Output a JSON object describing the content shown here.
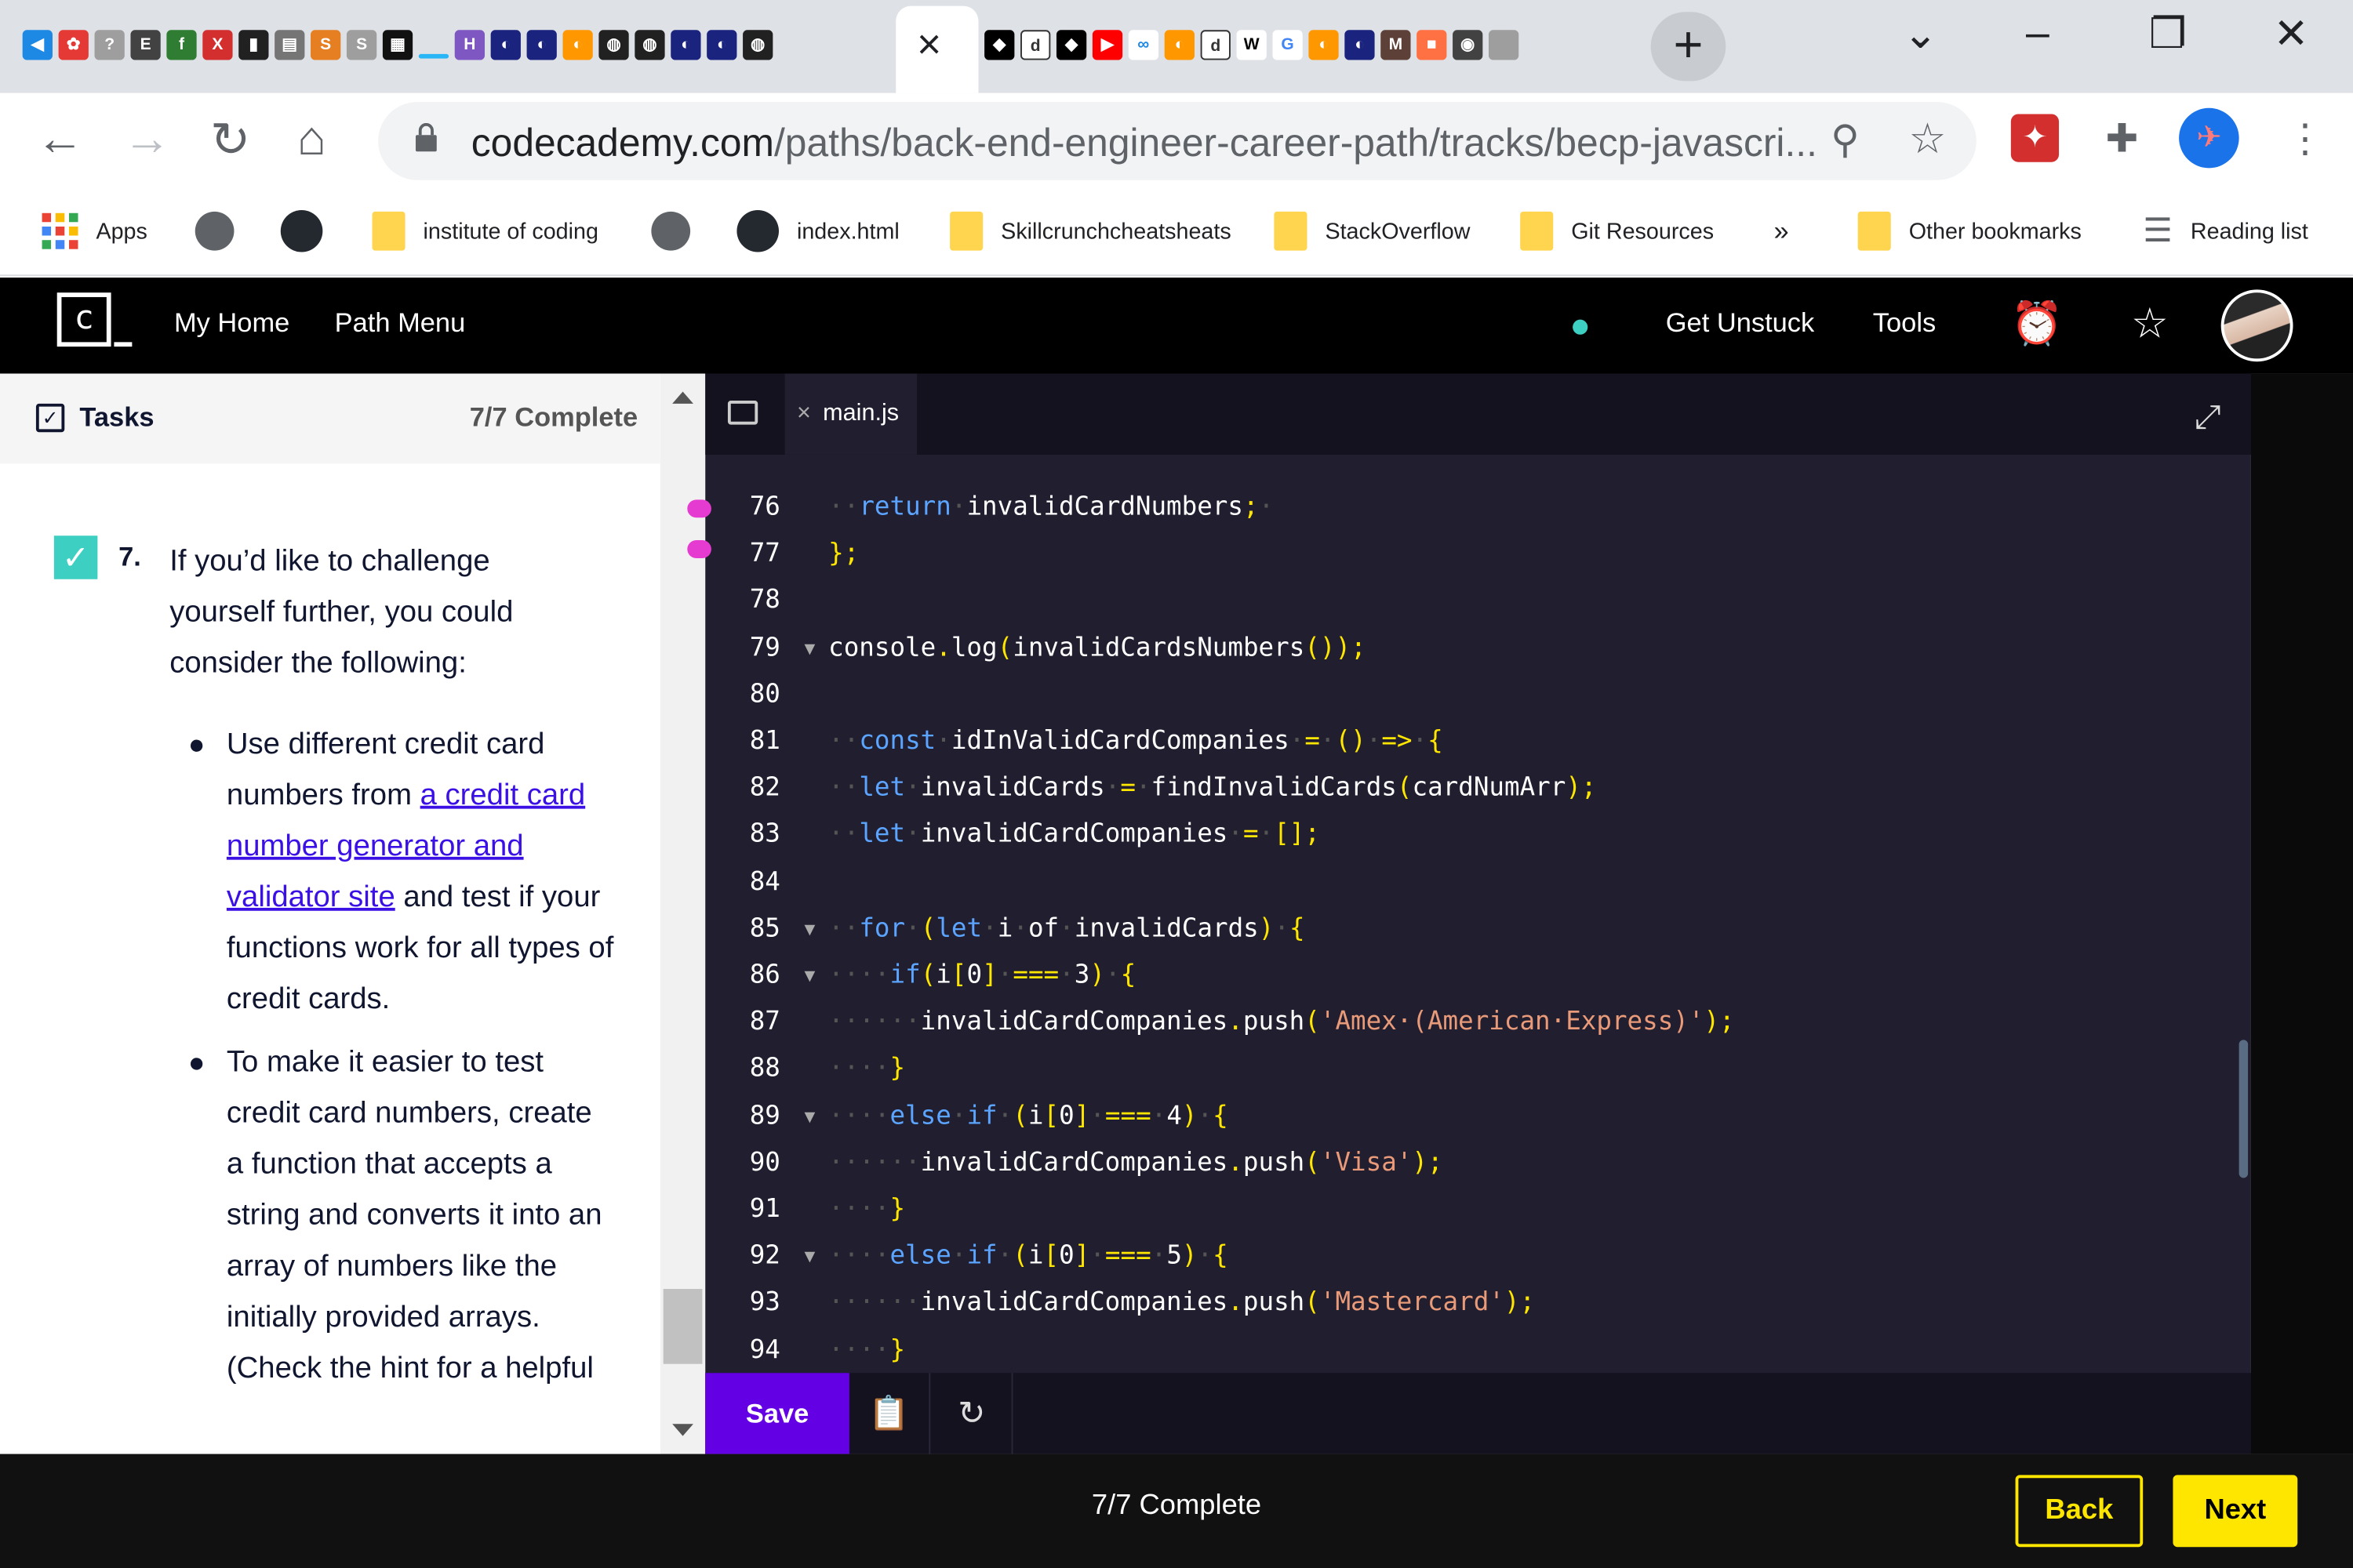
{
  "browser": {
    "active_tab_close": "×",
    "new_tab": "+",
    "url_host": "codecademy.com",
    "url_path": "/paths/back-end-engineer-career-path/tracks/becp-javascri...",
    "bookmarks": [
      "Apps",
      "institute of coding",
      "index.html",
      "Skillcrunchcheatsheats",
      "StackOverflow",
      "Git Resources",
      "»",
      "Other bookmarks",
      "Reading list"
    ]
  },
  "header": {
    "my_home": "My Home",
    "path_menu": "Path Menu",
    "get_unstuck": "Get Unstuck",
    "tools": "Tools"
  },
  "tasks": {
    "title": "Tasks",
    "progress": "7/7 Complete",
    "task_number": "7.",
    "intro": "If you’d like to challenge yourself further, you could consider the following:",
    "bullet1_before": "Use different credit card numbers from ",
    "bullet1_link": "a credit card number generator and validator site",
    "bullet1_after": " and test if your functions work for all types of credit cards.",
    "bullet2": "To make it easier to test credit card numbers, create a function that accepts a string and converts it into an array of numbers like the initially provided arrays. (Check the hint for a helpful"
  },
  "editor": {
    "file_name": "main.js",
    "save_label": "Save",
    "lines": [
      {
        "n": "76",
        "fold": "",
        "ind": "··",
        "tokens": [
          [
            "kw",
            "return"
          ],
          [
            "ws",
            "·"
          ],
          [
            "",
            "invalidCardNumbers"
          ],
          [
            "pun",
            ";"
          ],
          [
            "ws",
            "·"
          ]
        ]
      },
      {
        "n": "77",
        "fold": "",
        "ind": "",
        "tokens": [
          [
            "pun",
            "};"
          ]
        ]
      },
      {
        "n": "78",
        "fold": "",
        "ind": "",
        "tokens": []
      },
      {
        "n": "79",
        "fold": "▼",
        "ind": "",
        "tokens": [
          [
            "",
            "console"
          ],
          [
            "pun",
            "."
          ],
          [
            "",
            "log"
          ],
          [
            "pun",
            "("
          ],
          [
            "",
            "invalidCardsNumbers"
          ],
          [
            "pun",
            "());"
          ]
        ]
      },
      {
        "n": "80",
        "fold": "",
        "ind": "",
        "tokens": []
      },
      {
        "n": "81",
        "fold": "",
        "ind": "··",
        "tokens": [
          [
            "kw",
            "const"
          ],
          [
            "ws",
            "·"
          ],
          [
            "",
            "idInValidCardCompanies"
          ],
          [
            "ws",
            "·"
          ],
          [
            "pun",
            "="
          ],
          [
            "ws",
            "·"
          ],
          [
            "pun",
            "()"
          ],
          [
            "ws",
            "·"
          ],
          [
            "pun",
            "=>"
          ],
          [
            "ws",
            "·"
          ],
          [
            "pun",
            "{"
          ]
        ]
      },
      {
        "n": "82",
        "fold": "",
        "ind": "··",
        "tokens": [
          [
            "kw",
            "let"
          ],
          [
            "ws",
            "·"
          ],
          [
            "",
            "invalidCards"
          ],
          [
            "ws",
            "·"
          ],
          [
            "pun",
            "="
          ],
          [
            "ws",
            "·"
          ],
          [
            "",
            "findInvalidCards"
          ],
          [
            "pun",
            "("
          ],
          [
            "",
            "cardNumArr"
          ],
          [
            "pun",
            ");"
          ]
        ]
      },
      {
        "n": "83",
        "fold": "",
        "ind": "··",
        "tokens": [
          [
            "kw",
            "let"
          ],
          [
            "ws",
            "·"
          ],
          [
            "",
            "invalidCardCompanies"
          ],
          [
            "ws",
            "·"
          ],
          [
            "pun",
            "="
          ],
          [
            "ws",
            "·"
          ],
          [
            "pun",
            "[];"
          ]
        ]
      },
      {
        "n": "84",
        "fold": "",
        "ind": "",
        "tokens": []
      },
      {
        "n": "85",
        "fold": "▼",
        "ind": "··",
        "tokens": [
          [
            "kw",
            "for"
          ],
          [
            "ws",
            "·"
          ],
          [
            "pun",
            "("
          ],
          [
            "kw",
            "let"
          ],
          [
            "ws",
            "·"
          ],
          [
            "",
            "i"
          ],
          [
            "ws",
            "·"
          ],
          [
            "",
            "of"
          ],
          [
            "ws",
            "·"
          ],
          [
            "",
            "invalidCards"
          ],
          [
            "pun",
            ")"
          ],
          [
            "ws",
            "·"
          ],
          [
            "pun",
            "{"
          ]
        ]
      },
      {
        "n": "86",
        "fold": "▼",
        "ind": "····",
        "tokens": [
          [
            "kw",
            "if"
          ],
          [
            "pun",
            "("
          ],
          [
            "",
            "i"
          ],
          [
            "pun",
            "["
          ],
          [
            "",
            "0"
          ],
          [
            "pun",
            "]"
          ],
          [
            "ws",
            "·"
          ],
          [
            "pun",
            "==="
          ],
          [
            "ws",
            "·"
          ],
          [
            "",
            "3"
          ],
          [
            "pun",
            ")"
          ],
          [
            "ws",
            "·"
          ],
          [
            "pun",
            "{"
          ]
        ]
      },
      {
        "n": "87",
        "fold": "",
        "ind": "······",
        "tokens": [
          [
            "",
            "invalidCardCompanies"
          ],
          [
            "pun",
            "."
          ],
          [
            "",
            "push"
          ],
          [
            "pun",
            "("
          ],
          [
            "str",
            "'Amex·(American·Express)'"
          ],
          [
            "pun",
            ");"
          ]
        ]
      },
      {
        "n": "88",
        "fold": "",
        "ind": "····",
        "tokens": [
          [
            "pun",
            "}"
          ]
        ]
      },
      {
        "n": "89",
        "fold": "▼",
        "ind": "····",
        "tokens": [
          [
            "kw",
            "else"
          ],
          [
            "ws",
            "·"
          ],
          [
            "kw",
            "if"
          ],
          [
            "ws",
            "·"
          ],
          [
            "pun",
            "("
          ],
          [
            "",
            "i"
          ],
          [
            "pun",
            "["
          ],
          [
            "",
            "0"
          ],
          [
            "pun",
            "]"
          ],
          [
            "ws",
            "·"
          ],
          [
            "pun",
            "==="
          ],
          [
            "ws",
            "·"
          ],
          [
            "",
            "4"
          ],
          [
            "pun",
            ")"
          ],
          [
            "ws",
            "·"
          ],
          [
            "pun",
            "{"
          ]
        ]
      },
      {
        "n": "90",
        "fold": "",
        "ind": "······",
        "tokens": [
          [
            "",
            "invalidCardCompanies"
          ],
          [
            "pun",
            "."
          ],
          [
            "",
            "push"
          ],
          [
            "pun",
            "("
          ],
          [
            "str",
            "'Visa'"
          ],
          [
            "pun",
            ");"
          ]
        ]
      },
      {
        "n": "91",
        "fold": "",
        "ind": "····",
        "tokens": [
          [
            "pun",
            "}"
          ]
        ]
      },
      {
        "n": "92",
        "fold": "▼",
        "ind": "····",
        "tokens": [
          [
            "kw",
            "else"
          ],
          [
            "ws",
            "·"
          ],
          [
            "kw",
            "if"
          ],
          [
            "ws",
            "·"
          ],
          [
            "pun",
            "("
          ],
          [
            "",
            "i"
          ],
          [
            "pun",
            "["
          ],
          [
            "",
            "0"
          ],
          [
            "pun",
            "]"
          ],
          [
            "ws",
            "·"
          ],
          [
            "pun",
            "==="
          ],
          [
            "ws",
            "·"
          ],
          [
            "",
            "5"
          ],
          [
            "pun",
            ")"
          ],
          [
            "ws",
            "·"
          ],
          [
            "pun",
            "{"
          ]
        ]
      },
      {
        "n": "93",
        "fold": "",
        "ind": "······",
        "tokens": [
          [
            "",
            "invalidCardCompanies"
          ],
          [
            "pun",
            "."
          ],
          [
            "",
            "push"
          ],
          [
            "pun",
            "("
          ],
          [
            "str",
            "'Mastercard'"
          ],
          [
            "pun",
            ");"
          ]
        ]
      },
      {
        "n": "94",
        "fold": "",
        "ind": "····",
        "tokens": [
          [
            "pun",
            "}"
          ]
        ]
      }
    ]
  },
  "footer": {
    "progress": "7/7 Complete",
    "back": "Back",
    "next": "Next"
  },
  "colors": {
    "accent": "#6400e4",
    "yellow": "#ffe600",
    "teal": "#3ecfc3",
    "link": "#3a10e5"
  },
  "icons": [
    "vscode-icon",
    "folder-icon",
    "expand-icon",
    "alarm-icon",
    "star-icon",
    "copy-icon",
    "refresh-icon",
    "lock-icon",
    "zoom-icon",
    "puzzle-icon",
    "pdf-icon"
  ]
}
